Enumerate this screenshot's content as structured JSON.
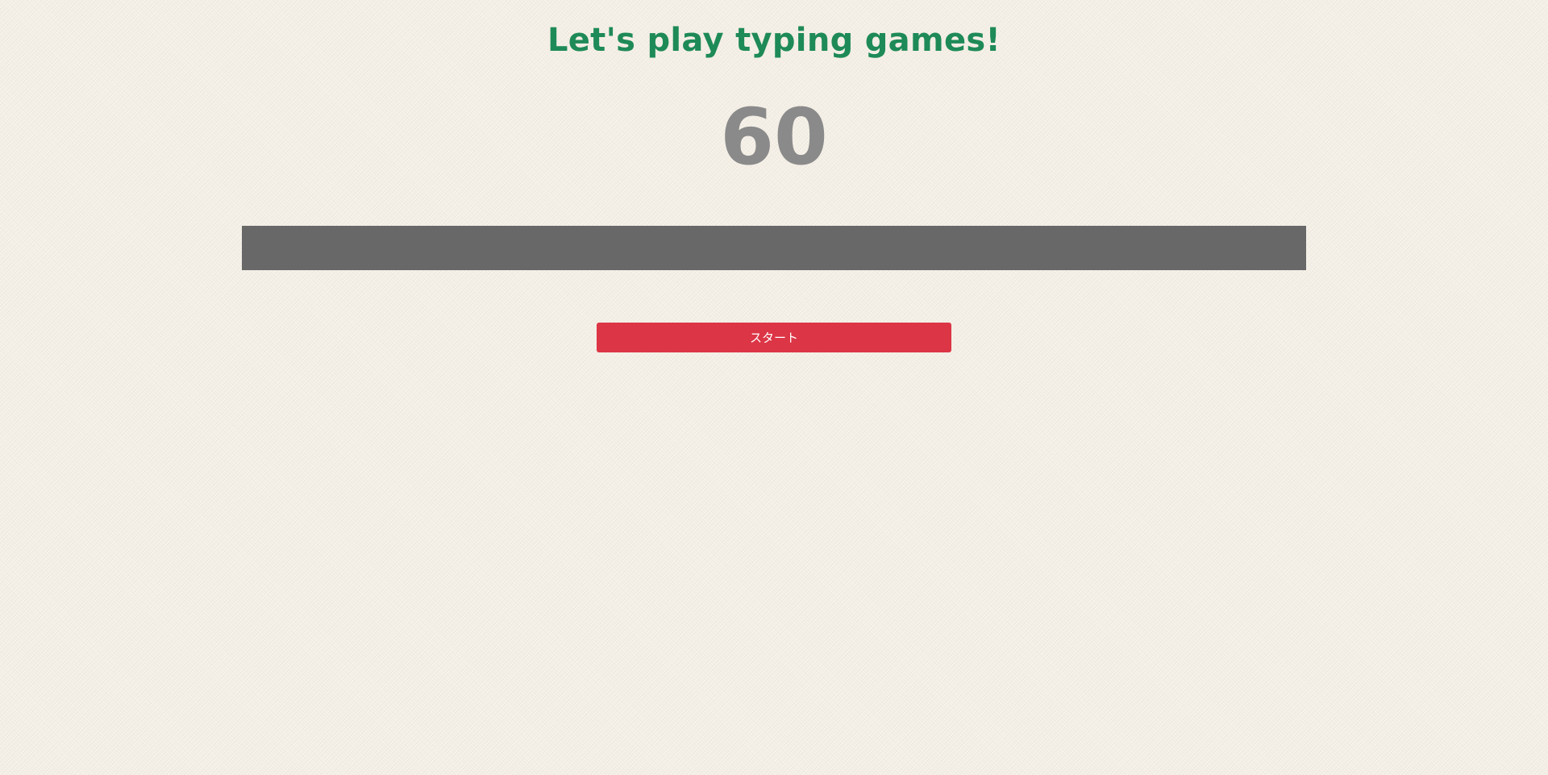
{
  "header": {
    "title": "Let's play typing games!"
  },
  "timer": {
    "value": "60"
  },
  "word_display": {
    "text": ""
  },
  "controls": {
    "start_label": "スタート"
  },
  "colors": {
    "title": "#1e8a57",
    "timer": "#8a8a8a",
    "bar": "#686868",
    "start_button": "#dc3545",
    "background": "#f6f2ea"
  }
}
